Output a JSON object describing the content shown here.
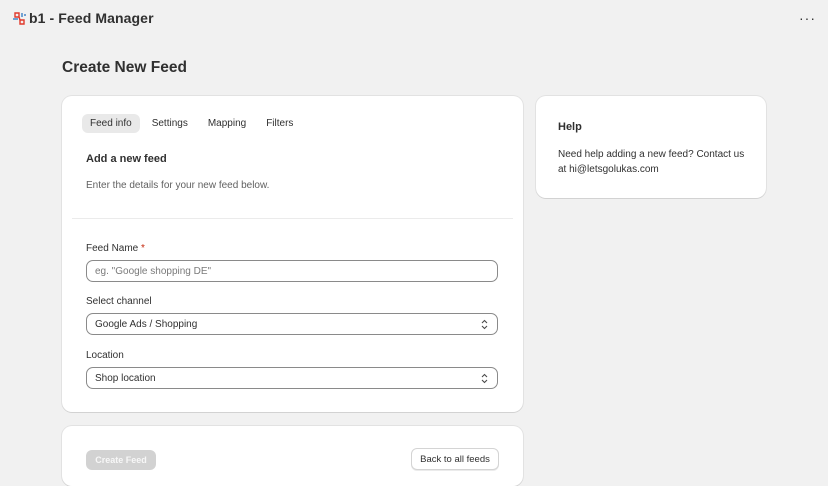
{
  "app": {
    "title": "b1 - Feed Manager",
    "logo_icon": "b1-logo-icon",
    "more_label": "···"
  },
  "page": {
    "title": "Create New Feed"
  },
  "tabs": [
    {
      "label": "Feed info",
      "active": true
    },
    {
      "label": "Settings",
      "active": false
    },
    {
      "label": "Mapping",
      "active": false
    },
    {
      "label": "Filters",
      "active": false
    }
  ],
  "section": {
    "title": "Add a new feed",
    "description": "Enter the details for your new feed below."
  },
  "form": {
    "feed_name": {
      "label": "Feed Name",
      "required_mark": "*",
      "value": "",
      "placeholder": "eg. \"Google shopping DE\""
    },
    "channel": {
      "label": "Select channel",
      "value": "Google Ads / Shopping"
    },
    "location": {
      "label": "Location",
      "value": "Shop location"
    }
  },
  "help": {
    "title": "Help",
    "text": "Need help adding a new feed? Contact us at hi@letsgolukas.com"
  },
  "footer": {
    "create_label": "Create Feed",
    "back_label": "Back to all feeds"
  },
  "colors": {
    "background": "#f1f1f1",
    "card": "#ffffff",
    "required": "#c5280c",
    "disabled_button": "#d2d2d2",
    "logo_red": "#e0392b"
  }
}
